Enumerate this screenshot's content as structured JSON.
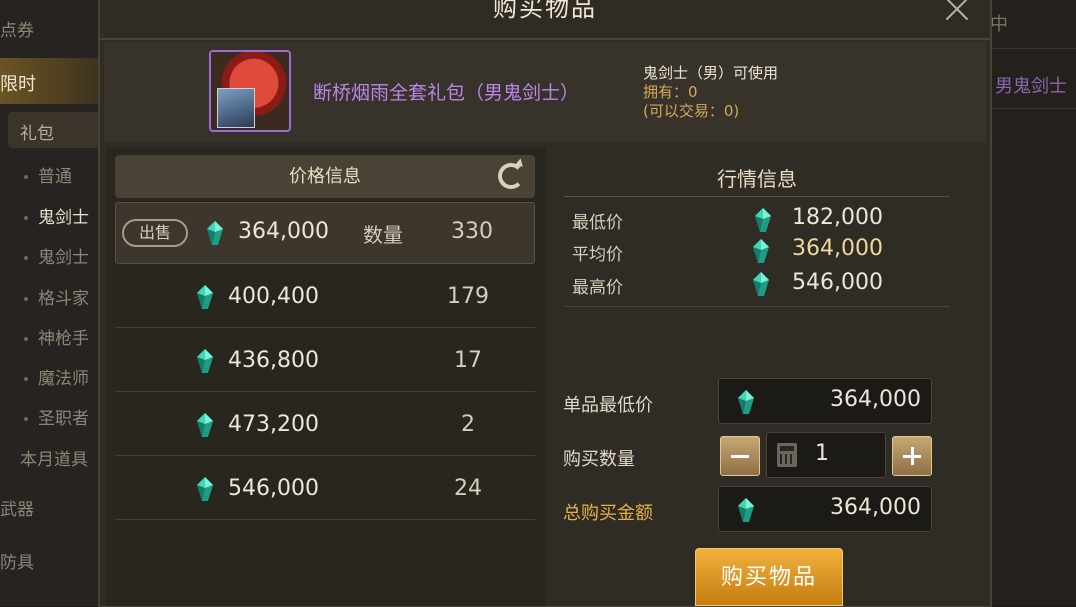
{
  "background": {
    "sidebar": {
      "items": [
        "点券",
        "限时",
        "礼包",
        "普通",
        "鬼剑士（",
        "鬼剑士（",
        "格斗家",
        "神枪手",
        "魔法师",
        "圣职者",
        "本月道具",
        "武器",
        "防具"
      ]
    },
    "right_panel": {
      "top_text": "中",
      "item_text": "男鬼剑士"
    }
  },
  "dialog": {
    "title": "购买物品",
    "item": {
      "name": "断桥烟雨全套礼包（男鬼剑士）",
      "usable_by": "鬼剑士（男）可使用",
      "owned": "拥有：0",
      "tradable": "(可以交易：0)"
    },
    "price_info": {
      "header": "价格信息",
      "sell_tag": "出售",
      "qty_label": "数量",
      "rows": [
        {
          "price": "364,000",
          "quantity": "330"
        },
        {
          "price": "400,400",
          "quantity": "179"
        },
        {
          "price": "436,800",
          "quantity": "17"
        },
        {
          "price": "473,200",
          "quantity": "2"
        },
        {
          "price": "546,000",
          "quantity": "24"
        }
      ]
    },
    "market_info": {
      "title": "行情信息",
      "min_label": "最低价",
      "min_value": "182,000",
      "avg_label": "平均价",
      "avg_value": "364,000",
      "max_label": "最高价",
      "max_value": "546,000"
    },
    "purchase": {
      "unit_price_label": "单品最低价",
      "unit_price": "364,000",
      "quantity_label": "购买数量",
      "quantity": "1",
      "total_label": "总购买金额",
      "total": "364,000",
      "buy_button": "购买物品"
    }
  },
  "colors": {
    "item_name": "#b986e8",
    "owned": "#d9a65a",
    "total_label": "#e6b049",
    "buy_button": "#e09a22",
    "gem": "#39c9a3"
  },
  "icons": [
    "close-icon",
    "refresh-icon",
    "gem-icon",
    "calculator-icon",
    "minus-icon",
    "plus-icon"
  ]
}
